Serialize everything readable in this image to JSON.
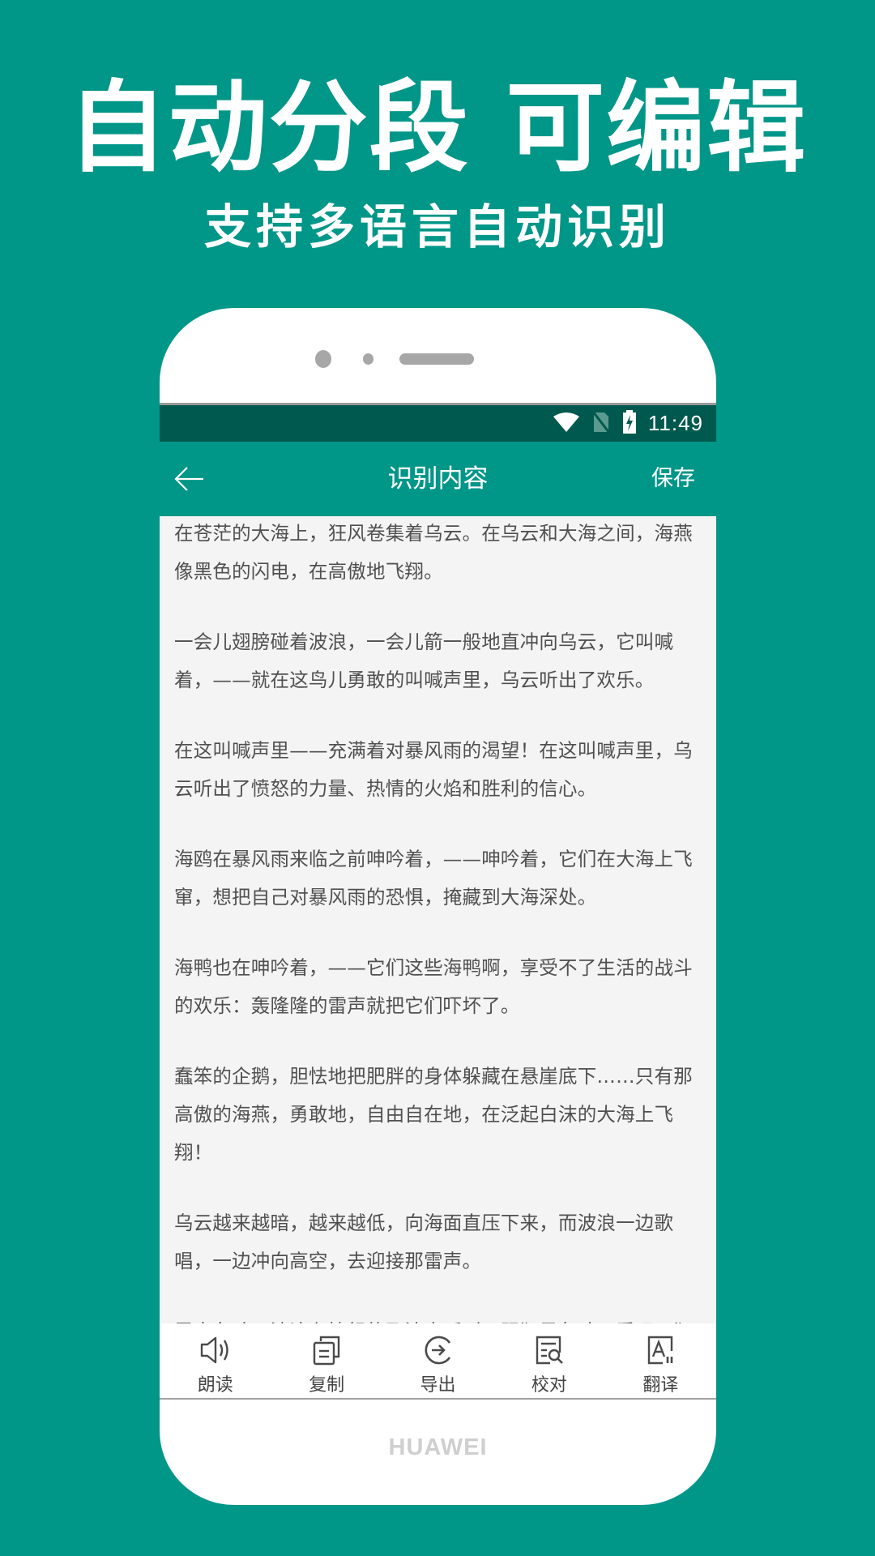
{
  "promo": {
    "title": "自动分段 可编辑",
    "subtitle": "支持多语言自动识别"
  },
  "statusbar": {
    "icons": [
      "wifi-icon",
      "no-sim-icon",
      "battery-charging-icon"
    ],
    "time": "11:49"
  },
  "appbar": {
    "back_icon": "arrow-left-icon",
    "title": "识别内容",
    "save_label": "保存"
  },
  "content": {
    "paragraphs": [
      "在苍茫的大海上，狂风卷集着乌云。在乌云和大海之间，海燕像黑色的闪电，在高傲地飞翔。",
      "一会儿翅膀碰着波浪，一会儿箭一般地直冲向乌云，它叫喊着，——就在这鸟儿勇敢的叫喊声里，乌云听出了欢乐。",
      "在这叫喊声里——充满着对暴风雨的渴望！在这叫喊声里，乌云听出了愤怒的力量、热情的火焰和胜利的信心。",
      "海鸥在暴风雨来临之前呻吟着，——呻吟着，它们在大海上飞窜，想把自己对暴风雨的恐惧，掩藏到大海深处。",
      "海鸭也在呻吟着，——它们这些海鸭啊，享受不了生活的战斗的欢乐：轰隆隆的雷声就把它们吓坏了。",
      "蠢笨的企鹅，胆怯地把肥胖的身体躲藏在悬崖底下……只有那高傲的海燕，勇敢地，自由自在地，在泛起白沫的大海上飞翔！",
      "乌云越来越暗，越来越低，向海面直压下来，而波浪一边歌唱，一边冲向高空，去迎接那雷声。",
      "雷声轰响。波浪在愤怒的飞沫中呼叫，跟狂风争鸣。看吧，狂"
    ]
  },
  "toolbar": {
    "items": [
      {
        "label": "朗读",
        "icon": "speaker-icon"
      },
      {
        "label": "复制",
        "icon": "copy-icon"
      },
      {
        "label": "导出",
        "icon": "export-icon"
      },
      {
        "label": "校对",
        "icon": "proofread-icon"
      },
      {
        "label": "翻译",
        "icon": "translate-icon"
      }
    ]
  },
  "device": {
    "brand": "HUAWEI"
  },
  "colors": {
    "background": "#009688",
    "statusbar": "#00594e",
    "appbar": "#009688",
    "content_bg": "#f4f4f4",
    "text": "#505050"
  }
}
